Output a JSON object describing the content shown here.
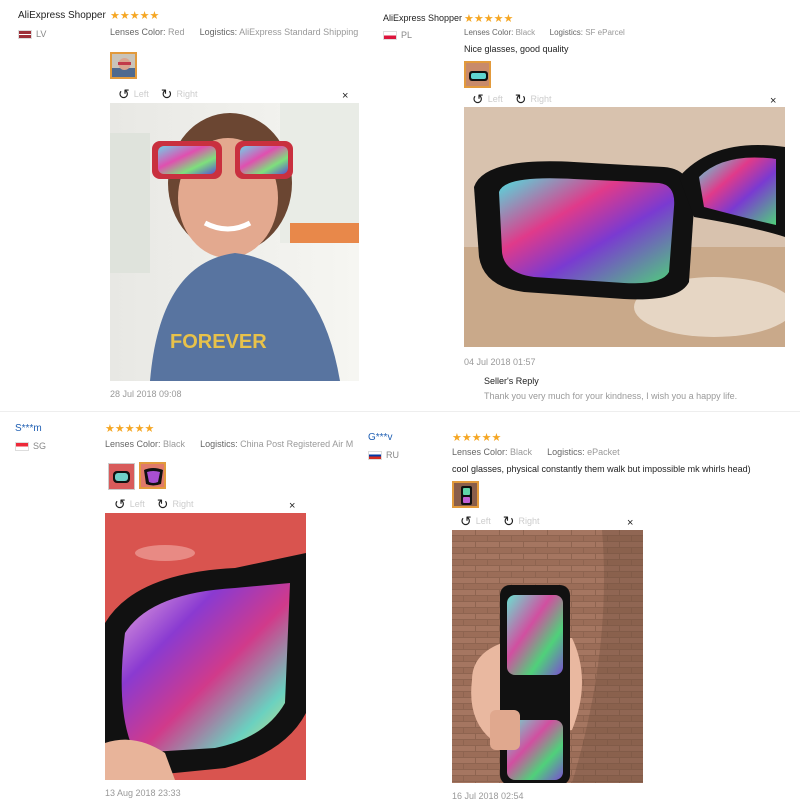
{
  "reviews": [
    {
      "user": "AliExpress Shopper",
      "country": "LV",
      "stars": "★★★★★",
      "lenses_label": "Lenses Color:",
      "lenses_value": "Red",
      "logistics_label": "Logistics:",
      "logistics_value": "AliExpress Standard Shipping",
      "left_label": "Left",
      "right_label": "Right",
      "close": "×",
      "date": "28 Jul 2018 09:08"
    },
    {
      "user": "AliExpress Shopper",
      "country": "PL",
      "stars": "★★★★★",
      "lenses_label": "Lenses Color:",
      "lenses_value": "Black",
      "logistics_label": "Logistics:",
      "logistics_value": "SF eParcel",
      "comment": "Nice glasses, good quality",
      "left_label": "Left",
      "right_label": "Right",
      "close": "×",
      "date": "04 Jul 2018 01:57",
      "reply_title": "Seller's Reply",
      "reply_text": "Thank you very much for your kindness, I wish you a happy life."
    },
    {
      "user": "S***m",
      "country": "SG",
      "stars": "★★★★★",
      "lenses_label": "Lenses Color:",
      "lenses_value": "Black",
      "logistics_label": "Logistics:",
      "logistics_value": "China Post Registered Air M",
      "left_label": "Left",
      "right_label": "Right",
      "close": "×",
      "date": "13 Aug 2018 23:33"
    },
    {
      "user": "G***v",
      "country": "RU",
      "stars": "★★★★★",
      "lenses_label": "Lenses Color:",
      "lenses_value": "Black",
      "logistics_label": "Logistics:",
      "logistics_value": "ePacket",
      "comment": "cool glasses, physical constantly them walk but impossible mk whirls head)",
      "left_label": "Left",
      "right_label": "Right",
      "close": "×",
      "date": "16 Jul 2018 02:54"
    }
  ],
  "icons": {
    "rotate_left": "↺",
    "rotate_right": "↻"
  },
  "colors": {
    "star": "#f5a623",
    "thumb_border": "#e29a3c",
    "user_link": "#1f5fb3"
  }
}
